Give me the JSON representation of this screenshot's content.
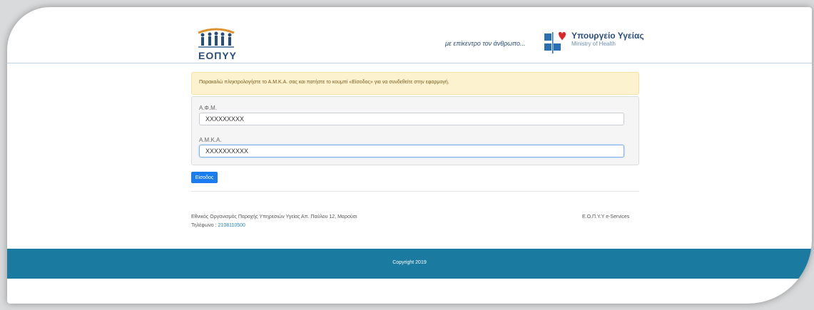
{
  "header": {
    "logo_text": "ΕΟΠΥΥ",
    "tagline": "με επίκεντρο τον άνθρωπο...",
    "ministry_title": "Υπουργείο Υγείας",
    "ministry_subtitle": "Ministry of Health"
  },
  "alert": {
    "message": "Παρακαλώ πληκτρολογήστε το Α.Μ.Κ.Α. σας και πατήστε το κουμπί «Είσοδος» για να συνδεθείτε στην εφαρμογή."
  },
  "form": {
    "afm_label": "Α.Φ.Μ.",
    "afm_value": "XXXXXXXXX",
    "amka_label": "Α.Μ.Κ.Α.",
    "amka_value": "XXXXXXXXXX",
    "submit_label": "Είσοδος"
  },
  "info": {
    "organization": "Εθνικός Οργανισμός Παροχής Υπηρεσιών Υγείας Απ. Παύλου 12, Μαρούσι",
    "phone_label": "Τηλέφωνο :",
    "phone_number": "2108110500",
    "service_name": "Ε.Ο.Π.Υ.Υ e-Services"
  },
  "footer": {
    "copyright": "Copyright 2019"
  },
  "colors": {
    "brand_blue": "#2a4d7a",
    "button_blue": "#1a7cef",
    "footer_teal": "#1a7aa0",
    "logo_orange": "#e0922e",
    "ministry_red": "#e0242a"
  }
}
